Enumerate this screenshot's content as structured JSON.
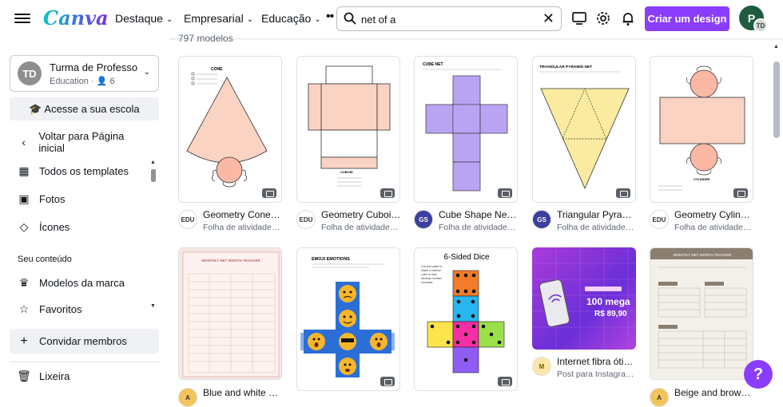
{
  "header": {
    "logo": "Canva",
    "nav": [
      {
        "label": "Destaque"
      },
      {
        "label": "Empresarial"
      },
      {
        "label": "Educação"
      }
    ],
    "more": "••",
    "search_value": "net of a",
    "search_icon": "search-icon",
    "clear_icon": "close-icon",
    "create_label": "Criar um design",
    "avatar_letter": "P",
    "avatar_mini": "TD"
  },
  "sidebar": {
    "team_initials": "TD",
    "team_name": "Turma de Professo…",
    "team_sub": "Education · 👤 6",
    "school_btn": "🎓 Acesse a sua escola",
    "back": "Voltar para Página inicial",
    "items": [
      {
        "label": "Todos os templates",
        "icon": "grid-icon"
      },
      {
        "label": "Fotos",
        "icon": "image-icon"
      },
      {
        "label": "Ícones",
        "icon": "shapes-icon"
      }
    ],
    "heading": "Seu conteúdo",
    "content_items": [
      {
        "label": "Modelos da marca",
        "icon": "brand-icon"
      },
      {
        "label": "Favoritos",
        "icon": "star-icon"
      }
    ],
    "invite": "Convidar membros",
    "trash": "Lixeira"
  },
  "results": {
    "count": "797 modelos",
    "row1": [
      {
        "title": "Geometry Cone …",
        "sub": "Folha de atividades, …",
        "author": "EDU"
      },
      {
        "title": "Geometry Cuboi…",
        "sub": "Folha de atividades, …",
        "author": "EDU"
      },
      {
        "title": "Cube Shape Net …",
        "sub": "Folha de atividades, …",
        "author": "GS"
      },
      {
        "title": "Triangular Pyram…",
        "sub": "Folha de atividades, …",
        "author": "GS"
      },
      {
        "title": "Geometry Cylind…",
        "sub": "Folha de atividades, …",
        "author": "EDU"
      }
    ],
    "row2": [
      {
        "title": "Blue and white m…",
        "author": "A"
      },
      {
        "title": "",
        "author": ""
      },
      {
        "title": "",
        "author": ""
      },
      {
        "title": "Internet fibra óti…",
        "sub": "Post para Instagram,…",
        "author": "M"
      },
      {
        "title": "Beige and brown …",
        "author": "A"
      }
    ],
    "thumb_text": {
      "cone": "CONE",
      "cuboid": "CUBOID",
      "cube": "CUBE NET",
      "pyramid": "TRIANGULAR PYRAMID NET",
      "cylinder": "CYLINDER",
      "tracker": "MONTHLY NET WORTH TRACKER",
      "emoji": "EMOJI EMOTIONS",
      "dice": "6-Sided Dice",
      "dice_sub": "Cut and paste to make a colorful cube to help develop number concepts",
      "internet_big": "100 mega",
      "internet_price": "R$ 89,90",
      "beige": "MONTHLY NET WORTH TRACKER"
    }
  },
  "help": "?",
  "colors": {
    "accent": "#8b3dff",
    "cone_fill": "#fbd3c3",
    "cube_fill": "#b9a4f4",
    "pyramid_fill": "#fbeba0"
  }
}
